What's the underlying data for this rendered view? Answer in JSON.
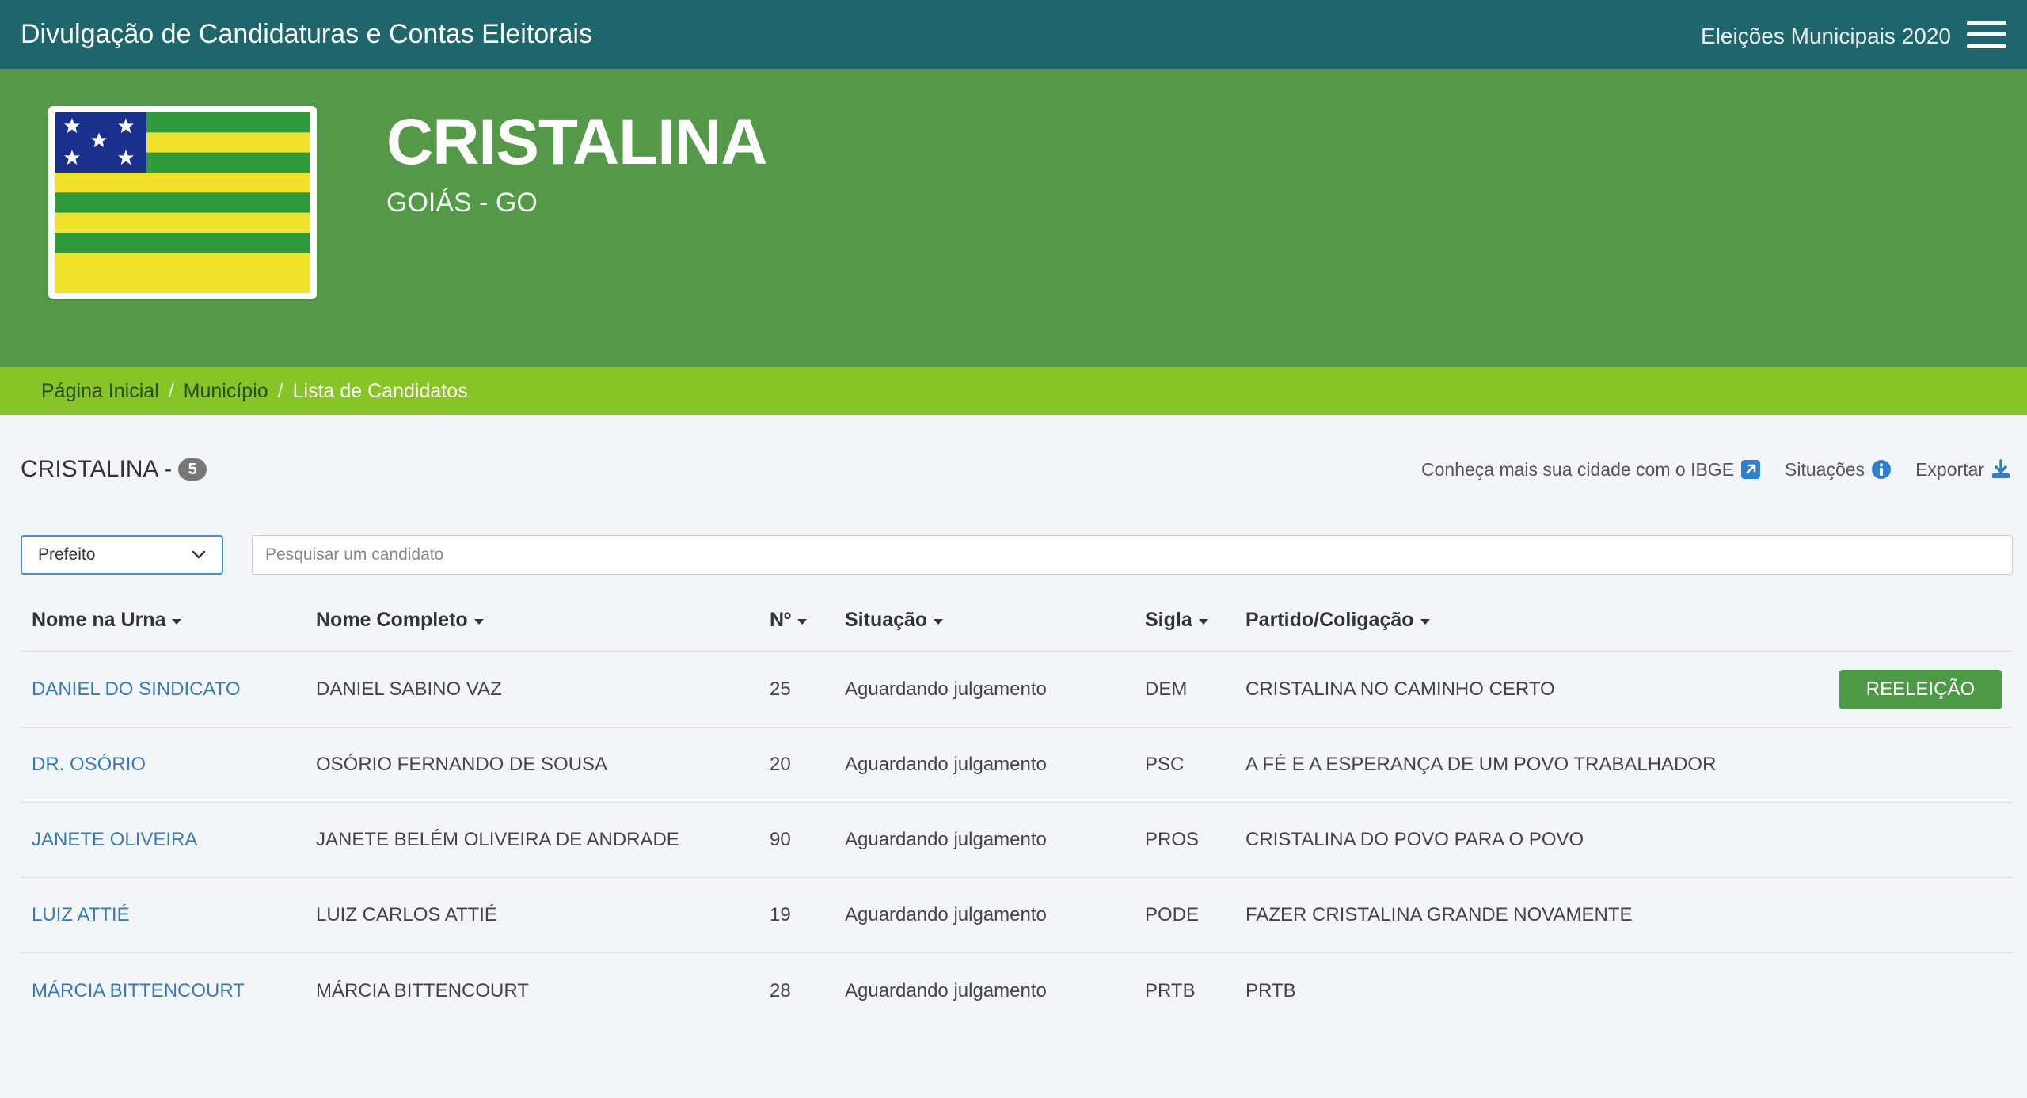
{
  "topbar": {
    "title": "Divulgação de Candidaturas e Contas Eleitorais",
    "election": "Eleições Municipais 2020"
  },
  "hero": {
    "city": "CRISTALINA",
    "state": "GOIÁS - GO"
  },
  "breadcrumb": {
    "items": [
      "Página Inicial",
      "Município",
      "Lista de Candidatos"
    ]
  },
  "list": {
    "title": "CRISTALINA -",
    "count": "5"
  },
  "tools": {
    "ibge": "Conheça mais sua cidade com o IBGE",
    "situacoes": "Situações",
    "exportar": "Exportar"
  },
  "filters": {
    "cargo": "Prefeito",
    "search_placeholder": "Pesquisar um candidato"
  },
  "table": {
    "headers": [
      "Nome na Urna",
      "Nome Completo",
      "Nº",
      "Situação",
      "Sigla",
      "Partido/Coligação"
    ],
    "rows": [
      {
        "urna": "DANIEL DO SINDICATO",
        "completo": "DANIEL SABINO VAZ",
        "num": "25",
        "situacao": "Aguardando julgamento",
        "sigla": "DEM",
        "partido": "CRISTALINA NO CAMINHO CERTO",
        "tag": "REELEIÇÃO"
      },
      {
        "urna": "DR. OSÓRIO",
        "completo": "OSÓRIO FERNANDO DE SOUSA",
        "num": "20",
        "situacao": "Aguardando julgamento",
        "sigla": "PSC",
        "partido": "A FÉ E A ESPERANÇA DE UM POVO TRABALHADOR",
        "tag": ""
      },
      {
        "urna": "JANETE OLIVEIRA",
        "completo": "JANETE BELÉM OLIVEIRA DE ANDRADE",
        "num": "90",
        "situacao": "Aguardando julgamento",
        "sigla": "PROS",
        "partido": "CRISTALINA DO POVO PARA O POVO",
        "tag": ""
      },
      {
        "urna": "LUIZ ATTIÉ",
        "completo": "LUIZ CARLOS ATTIÉ",
        "num": "19",
        "situacao": "Aguardando julgamento",
        "sigla": "PODE",
        "partido": "FAZER CRISTALINA GRANDE NOVAMENTE",
        "tag": ""
      },
      {
        "urna": "MÁRCIA BITTENCOURT",
        "completo": "MÁRCIA BITTENCOURT",
        "num": "28",
        "situacao": "Aguardando julgamento",
        "sigla": "PRTB",
        "partido": "PRTB",
        "tag": ""
      }
    ]
  },
  "colors": {
    "topbar": "#1e666c",
    "hero": "#539947",
    "breadcrumb": "#87c425",
    "link": "#3a7ab8",
    "reelection": "#4d9a44"
  },
  "icons": {
    "menu": "hamburger-icon",
    "ibge": "external-link-icon",
    "situacoes": "info-icon",
    "exportar": "download-icon",
    "flag": "goias-flag"
  }
}
